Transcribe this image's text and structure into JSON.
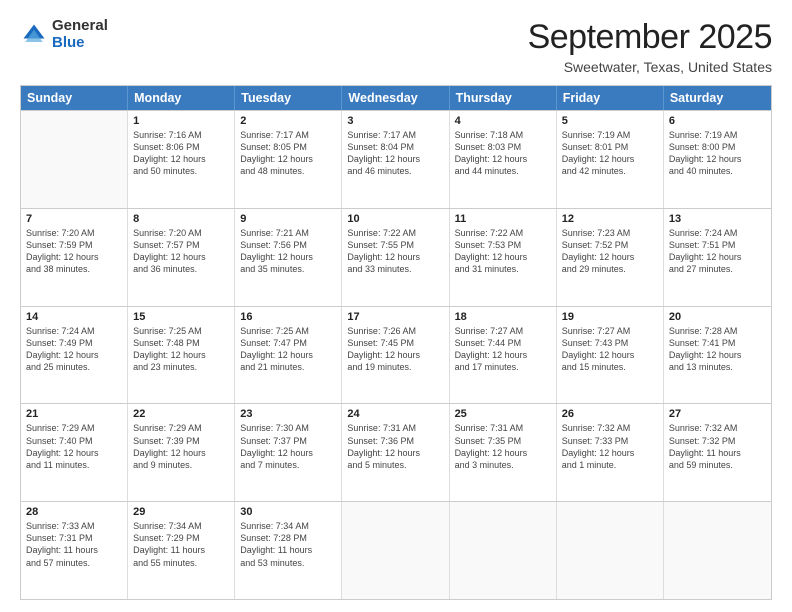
{
  "logo": {
    "general": "General",
    "blue": "Blue"
  },
  "title": "September 2025",
  "location": "Sweetwater, Texas, United States",
  "header_days": [
    "Sunday",
    "Monday",
    "Tuesday",
    "Wednesday",
    "Thursday",
    "Friday",
    "Saturday"
  ],
  "weeks": [
    [
      {
        "day": "",
        "info": ""
      },
      {
        "day": "1",
        "info": "Sunrise: 7:16 AM\nSunset: 8:06 PM\nDaylight: 12 hours\nand 50 minutes."
      },
      {
        "day": "2",
        "info": "Sunrise: 7:17 AM\nSunset: 8:05 PM\nDaylight: 12 hours\nand 48 minutes."
      },
      {
        "day": "3",
        "info": "Sunrise: 7:17 AM\nSunset: 8:04 PM\nDaylight: 12 hours\nand 46 minutes."
      },
      {
        "day": "4",
        "info": "Sunrise: 7:18 AM\nSunset: 8:03 PM\nDaylight: 12 hours\nand 44 minutes."
      },
      {
        "day": "5",
        "info": "Sunrise: 7:19 AM\nSunset: 8:01 PM\nDaylight: 12 hours\nand 42 minutes."
      },
      {
        "day": "6",
        "info": "Sunrise: 7:19 AM\nSunset: 8:00 PM\nDaylight: 12 hours\nand 40 minutes."
      }
    ],
    [
      {
        "day": "7",
        "info": "Sunrise: 7:20 AM\nSunset: 7:59 PM\nDaylight: 12 hours\nand 38 minutes."
      },
      {
        "day": "8",
        "info": "Sunrise: 7:20 AM\nSunset: 7:57 PM\nDaylight: 12 hours\nand 36 minutes."
      },
      {
        "day": "9",
        "info": "Sunrise: 7:21 AM\nSunset: 7:56 PM\nDaylight: 12 hours\nand 35 minutes."
      },
      {
        "day": "10",
        "info": "Sunrise: 7:22 AM\nSunset: 7:55 PM\nDaylight: 12 hours\nand 33 minutes."
      },
      {
        "day": "11",
        "info": "Sunrise: 7:22 AM\nSunset: 7:53 PM\nDaylight: 12 hours\nand 31 minutes."
      },
      {
        "day": "12",
        "info": "Sunrise: 7:23 AM\nSunset: 7:52 PM\nDaylight: 12 hours\nand 29 minutes."
      },
      {
        "day": "13",
        "info": "Sunrise: 7:24 AM\nSunset: 7:51 PM\nDaylight: 12 hours\nand 27 minutes."
      }
    ],
    [
      {
        "day": "14",
        "info": "Sunrise: 7:24 AM\nSunset: 7:49 PM\nDaylight: 12 hours\nand 25 minutes."
      },
      {
        "day": "15",
        "info": "Sunrise: 7:25 AM\nSunset: 7:48 PM\nDaylight: 12 hours\nand 23 minutes."
      },
      {
        "day": "16",
        "info": "Sunrise: 7:25 AM\nSunset: 7:47 PM\nDaylight: 12 hours\nand 21 minutes."
      },
      {
        "day": "17",
        "info": "Sunrise: 7:26 AM\nSunset: 7:45 PM\nDaylight: 12 hours\nand 19 minutes."
      },
      {
        "day": "18",
        "info": "Sunrise: 7:27 AM\nSunset: 7:44 PM\nDaylight: 12 hours\nand 17 minutes."
      },
      {
        "day": "19",
        "info": "Sunrise: 7:27 AM\nSunset: 7:43 PM\nDaylight: 12 hours\nand 15 minutes."
      },
      {
        "day": "20",
        "info": "Sunrise: 7:28 AM\nSunset: 7:41 PM\nDaylight: 12 hours\nand 13 minutes."
      }
    ],
    [
      {
        "day": "21",
        "info": "Sunrise: 7:29 AM\nSunset: 7:40 PM\nDaylight: 12 hours\nand 11 minutes."
      },
      {
        "day": "22",
        "info": "Sunrise: 7:29 AM\nSunset: 7:39 PM\nDaylight: 12 hours\nand 9 minutes."
      },
      {
        "day": "23",
        "info": "Sunrise: 7:30 AM\nSunset: 7:37 PM\nDaylight: 12 hours\nand 7 minutes."
      },
      {
        "day": "24",
        "info": "Sunrise: 7:31 AM\nSunset: 7:36 PM\nDaylight: 12 hours\nand 5 minutes."
      },
      {
        "day": "25",
        "info": "Sunrise: 7:31 AM\nSunset: 7:35 PM\nDaylight: 12 hours\nand 3 minutes."
      },
      {
        "day": "26",
        "info": "Sunrise: 7:32 AM\nSunset: 7:33 PM\nDaylight: 12 hours\nand 1 minute."
      },
      {
        "day": "27",
        "info": "Sunrise: 7:32 AM\nSunset: 7:32 PM\nDaylight: 11 hours\nand 59 minutes."
      }
    ],
    [
      {
        "day": "28",
        "info": "Sunrise: 7:33 AM\nSunset: 7:31 PM\nDaylight: 11 hours\nand 57 minutes."
      },
      {
        "day": "29",
        "info": "Sunrise: 7:34 AM\nSunset: 7:29 PM\nDaylight: 11 hours\nand 55 minutes."
      },
      {
        "day": "30",
        "info": "Sunrise: 7:34 AM\nSunset: 7:28 PM\nDaylight: 11 hours\nand 53 minutes."
      },
      {
        "day": "",
        "info": ""
      },
      {
        "day": "",
        "info": ""
      },
      {
        "day": "",
        "info": ""
      },
      {
        "day": "",
        "info": ""
      }
    ]
  ]
}
